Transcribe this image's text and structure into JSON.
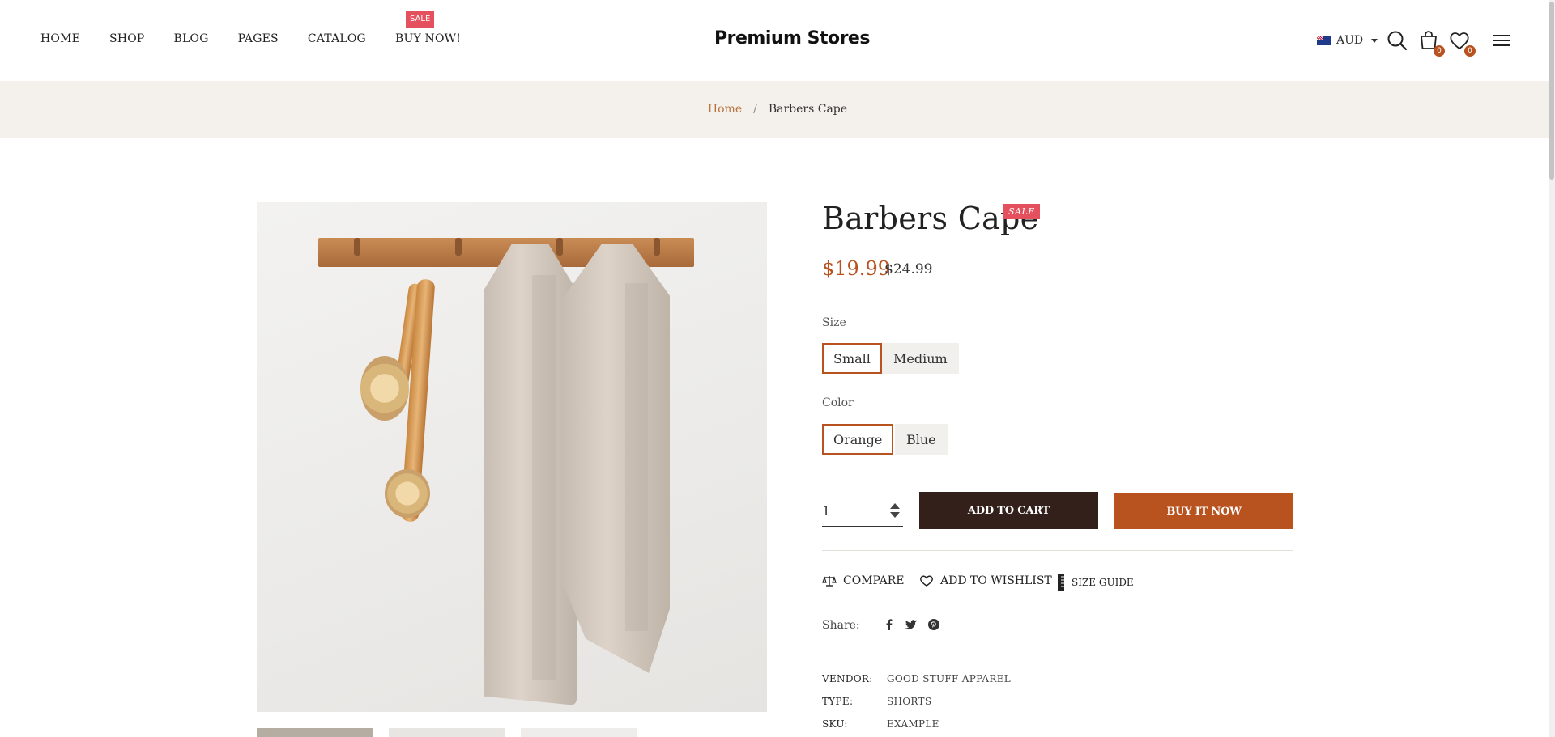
{
  "header": {
    "nav": [
      "HOME",
      "SHOP",
      "BLOG",
      "PAGES",
      "CATALOG",
      "BUY NOW!"
    ],
    "nav_badge": "SALE",
    "logo": "Premium Stores",
    "currency": "AUD",
    "cart_count": "0",
    "wishlist_count": "0",
    "icons": [
      "search-icon",
      "cart-icon",
      "heart-icon",
      "menu-icon"
    ]
  },
  "breadcrumb": {
    "home": "Home",
    "separator": "/",
    "current": "Barbers Cape"
  },
  "product": {
    "title": "Barbers Cape",
    "badge": "SALE",
    "price": "$19.99",
    "compare_price": "$24.99",
    "size_label": "Size",
    "sizes": [
      "Small",
      "Medium"
    ],
    "selected_size": "Small",
    "color_label": "Color",
    "colors": [
      "Orange",
      "Blue"
    ],
    "selected_color": "Orange",
    "quantity": "1",
    "add_to_cart": "ADD TO CART",
    "buy_now": "BUY IT NOW",
    "actions": {
      "compare": "COMPARE",
      "wishlist": "ADD TO WISHLIST",
      "size_guide": "SIZE GUIDE"
    },
    "share_label": "Share:",
    "share_icons": [
      "facebook-icon",
      "twitter-icon",
      "pinterest-icon"
    ],
    "meta": [
      {
        "key": "VENDOR:",
        "value": "GOOD STUFF APPAREL"
      },
      {
        "key": "TYPE:",
        "value": "SHORTS"
      },
      {
        "key": "SKU:",
        "value": "EXAMPLE"
      }
    ]
  },
  "colors": {
    "accent": "#b8531f",
    "dark_button": "#33201a",
    "sale": "#e4505d",
    "breadcrumb_bg": "#f4f1ec"
  }
}
